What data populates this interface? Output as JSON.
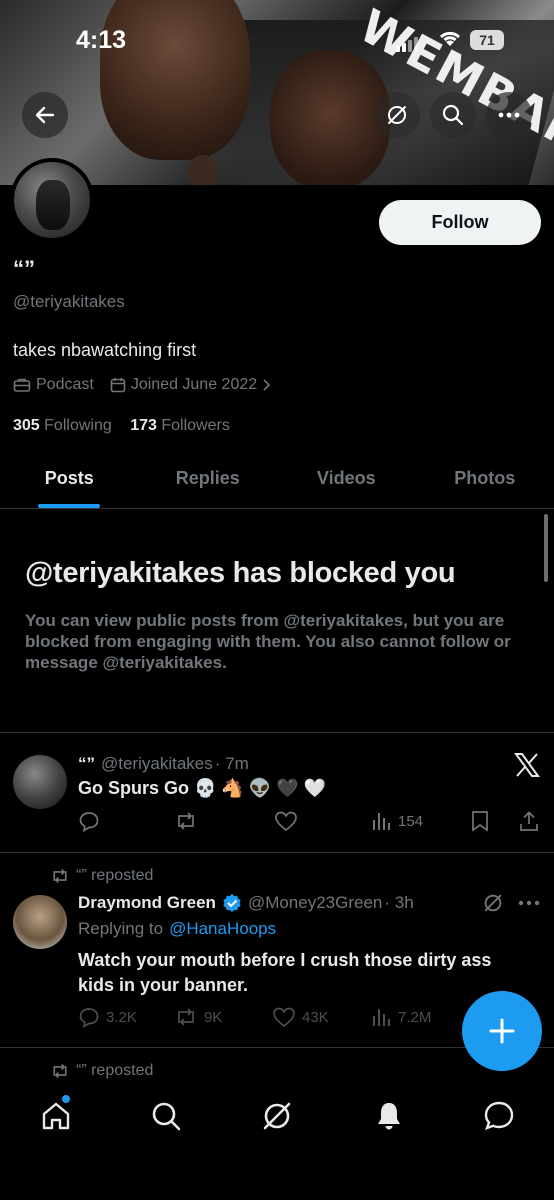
{
  "status_bar": {
    "time": "4:13",
    "battery": "71"
  },
  "profile": {
    "display_name": "“”",
    "handle": "@teriyakitakes",
    "bio": "takes nbawatching first",
    "category": "Podcast",
    "joined": "Joined June 2022",
    "following_count": "305",
    "following_label": "Following",
    "followers_count": "173",
    "followers_label": "Followers",
    "follow_label": "Follow",
    "banner_text": "WEMBANYAMA"
  },
  "tabs": [
    {
      "label": "Posts",
      "active": true
    },
    {
      "label": "Replies",
      "active": false
    },
    {
      "label": "Videos",
      "active": false
    },
    {
      "label": "Photos",
      "active": false
    }
  ],
  "blocked": {
    "title": "@teriyakitakes has blocked you",
    "text": "You can view public posts from @teriyakitakes, but you are blocked from engaging with them. You also cannot follow or message @teriyakitakes."
  },
  "posts": [
    {
      "author": "“”",
      "handle": "@teriyakitakes",
      "time": "· 7m",
      "text": "Go Spurs Go 💀 🐴 👽 🖤 🤍",
      "views": "154"
    },
    {
      "repost_label": "“” reposted",
      "author": "Draymond Green",
      "handle": "@Money23Green",
      "time": "· 3h",
      "replying_prefix": "Replying to",
      "replying_to": "@HanaHoops",
      "text": "Watch your mouth before I crush those dirty ass kids in your banner.",
      "replies": "3.2K",
      "reposts": "9K",
      "likes": "43K",
      "views": "7.2M"
    }
  ],
  "third_repost_label": "“” reposted",
  "colors": {
    "accent": "#1d9bf0",
    "background": "#000000",
    "muted": "#71767b",
    "text": "#e7e9ea"
  },
  "icons": [
    "back-arrow-icon",
    "grok-icon",
    "search-icon",
    "more-icon",
    "briefcase-icon",
    "calendar-icon",
    "chevron-right-icon",
    "x-logo-icon",
    "reply-icon",
    "repost-icon",
    "like-icon",
    "views-icon",
    "bookmark-icon",
    "share-icon",
    "verified-badge-icon",
    "compose-icon",
    "home-icon",
    "notifications-icon",
    "messages-icon"
  ]
}
